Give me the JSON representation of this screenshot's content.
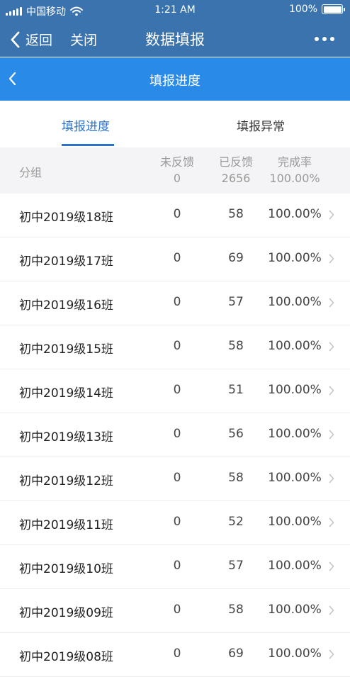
{
  "status_bar": {
    "carrier": "中国移动",
    "time": "1:21 AM",
    "battery": "100%"
  },
  "nav": {
    "back_label": "返回",
    "close_label": "关闭",
    "title": "数据填报"
  },
  "subheader": {
    "title": "填报进度"
  },
  "tabs": [
    {
      "label": "填报进度",
      "active": true
    },
    {
      "label": "填报异常",
      "active": false
    }
  ],
  "table": {
    "group_header": "分组",
    "columns": [
      {
        "label": "未反馈",
        "total": "0"
      },
      {
        "label": "已反馈",
        "total": "2656"
      },
      {
        "label": "完成率",
        "total": "100.00%"
      }
    ],
    "rows": [
      {
        "name": "初中2019级18班",
        "pending": "0",
        "done": "58",
        "rate": "100.00%"
      },
      {
        "name": "初中2019级17班",
        "pending": "0",
        "done": "69",
        "rate": "100.00%"
      },
      {
        "name": "初中2019级16班",
        "pending": "0",
        "done": "57",
        "rate": "100.00%"
      },
      {
        "name": "初中2019级15班",
        "pending": "0",
        "done": "58",
        "rate": "100.00%"
      },
      {
        "name": "初中2019级14班",
        "pending": "0",
        "done": "51",
        "rate": "100.00%"
      },
      {
        "name": "初中2019级13班",
        "pending": "0",
        "done": "56",
        "rate": "100.00%"
      },
      {
        "name": "初中2019级12班",
        "pending": "0",
        "done": "58",
        "rate": "100.00%"
      },
      {
        "name": "初中2019级11班",
        "pending": "0",
        "done": "52",
        "rate": "100.00%"
      },
      {
        "name": "初中2019级10班",
        "pending": "0",
        "done": "57",
        "rate": "100.00%"
      },
      {
        "name": "初中2019级09班",
        "pending": "0",
        "done": "58",
        "rate": "100.00%"
      },
      {
        "name": "初中2019级08班",
        "pending": "0",
        "done": "69",
        "rate": "100.00%"
      }
    ]
  },
  "colors": {
    "nav_bg": "#3a73ad",
    "subheader_bg": "#2a8ae8",
    "tab_active": "#2a73c8"
  }
}
